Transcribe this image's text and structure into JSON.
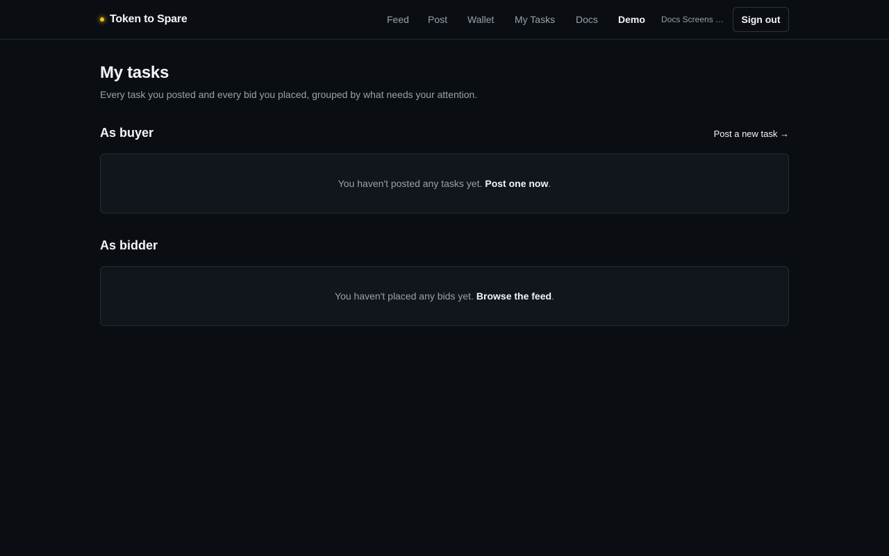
{
  "brand": {
    "name": "Token to Spare",
    "dot_color": "#f5c116"
  },
  "nav": {
    "links": [
      {
        "label": "Feed",
        "active": false
      },
      {
        "label": "Post",
        "active": false
      },
      {
        "label": "Wallet",
        "active": false
      },
      {
        "label": "My Tasks",
        "active": false
      },
      {
        "label": "Docs",
        "active": false
      },
      {
        "label": "Demo",
        "active": true
      }
    ],
    "user_label": "Docs Screens B...",
    "signout_label": "Sign out"
  },
  "page": {
    "title": "My tasks",
    "subtitle": "Every task you posted and every bid you placed, grouped by what needs your attention."
  },
  "buyer": {
    "title": "As buyer",
    "action_label": "Post a new task →",
    "empty_text": "You haven't posted any tasks yet.",
    "empty_link": "Post one now",
    "empty_suffix": "."
  },
  "bidder": {
    "title": "As bidder",
    "empty_text": "You haven't placed any bids yet.",
    "empty_link": "Browse the feed",
    "empty_suffix": "."
  },
  "colors": {
    "background": "#0a0e13",
    "card": "#11151c",
    "border": "#262b33",
    "muted_text": "#9aa1ab",
    "text": "#f3f5f7",
    "accent": "#f5c116"
  }
}
